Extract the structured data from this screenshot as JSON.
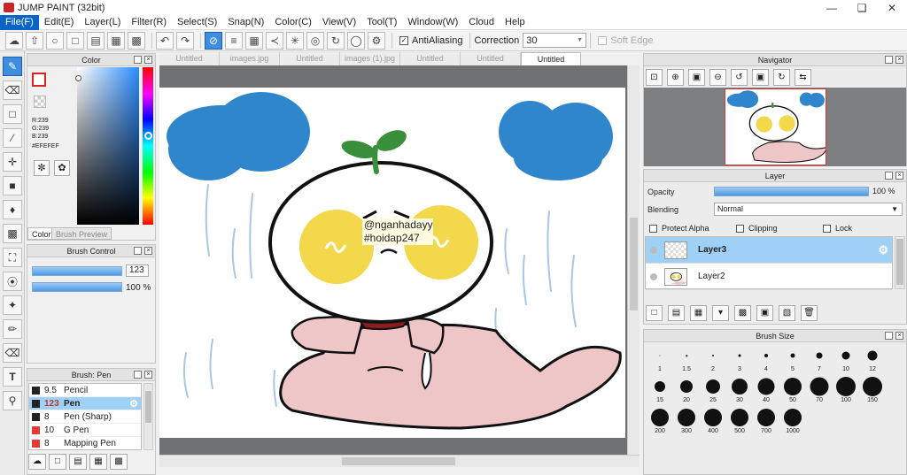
{
  "window": {
    "title": "JUMP PAINT (32bit)"
  },
  "menu": [
    "File(F)",
    "Edit(E)",
    "Layer(L)",
    "Filter(R)",
    "Select(S)",
    "Snap(N)",
    "Color(C)",
    "View(V)",
    "Tool(T)",
    "Window(W)",
    "Cloud",
    "Help"
  ],
  "toolbar": {
    "antialias_label": "AntiAliasing",
    "correction_label": "Correction",
    "correction_value": "30",
    "soft_edge_label": "Soft Edge"
  },
  "color_panel": {
    "title": "Color",
    "r": "R:239",
    "g": "G:239",
    "b": "B:239",
    "hex": "#EFEFEF",
    "tab_color": "Color",
    "tab_preview": "Brush Preview",
    "current_color": "#efefef"
  },
  "brush_control": {
    "title": "Brush Control",
    "size_value": "123",
    "opacity_value": "100 %"
  },
  "brush_panel": {
    "title": "Brush: Pen",
    "items": [
      {
        "size": "9.5",
        "name": "Pencil",
        "color": "#222222"
      },
      {
        "size": "123",
        "name": "Pen",
        "color": "#222222",
        "selected": true
      },
      {
        "size": "8",
        "name": "Pen (Sharp)",
        "color": "#222222"
      },
      {
        "size": "10",
        "name": "G Pen",
        "color": "#e53935"
      },
      {
        "size": "8",
        "name": "Mapping Pen",
        "color": "#e53935"
      }
    ]
  },
  "doc_tabs": [
    "Untitled",
    "images.jpg",
    "Untitled",
    "images (1).jpg",
    "Untitled",
    "Untitled",
    "Untitled"
  ],
  "canvas": {
    "watermark_line1": "@nganhadayy",
    "watermark_line2": "#hoidap247"
  },
  "navigator": {
    "title": "Navigator"
  },
  "layer_panel": {
    "title": "Layer",
    "opacity_label": "Opacity",
    "opacity_value": "100 %",
    "blending_label": "Blending",
    "blending_value": "Normal",
    "protect_alpha": "Protect Alpha",
    "clipping": "Clipping",
    "lock": "Lock",
    "layers": [
      {
        "name": "Layer3",
        "selected": true
      },
      {
        "name": "Layer2",
        "selected": false
      }
    ]
  },
  "brush_size": {
    "title": "Brush Size",
    "sizes": [
      "1",
      "1.5",
      "2",
      "3",
      "4",
      "5",
      "7",
      "10",
      "12",
      "15",
      "20",
      "25",
      "30",
      "40",
      "50",
      "70",
      "100",
      "150",
      "200",
      "300",
      "400",
      "500",
      "700",
      "1000"
    ]
  },
  "colors": {
    "accent": "#3d8de0",
    "selection": "#9fd0f5",
    "cloud_blue": "#2f86cc",
    "cheek_yellow": "#f2d84a",
    "cape_pink": "#efc6c8",
    "sprout_green": "#3a8f3a"
  }
}
